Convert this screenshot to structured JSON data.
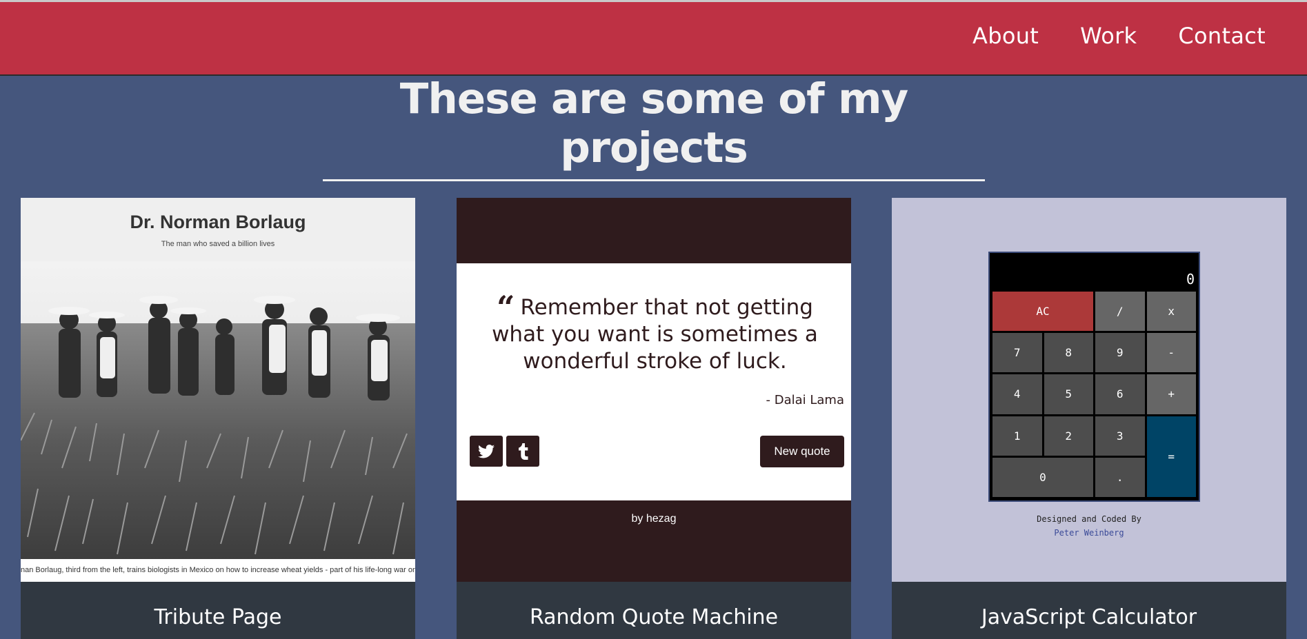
{
  "nav": {
    "items": [
      "About",
      "Work",
      "Contact"
    ]
  },
  "projects_title": "These are some of my projects",
  "projects": [
    {
      "caption": "Tribute Page",
      "name": "Dr. Norman Borlaug",
      "tagline": "The man who saved a billion lives",
      "photo_caption": "nan Borlaug, third from the left, trains biologists in Mexico on how to increase wheat yields - part of his life-long war on"
    },
    {
      "caption": "Random Quote Machine",
      "quote": "Remember that not getting what you want is sometimes a wonderful stroke of luck.",
      "author": "- Dalai Lama",
      "new_quote_label": "New quote",
      "byline": "by hezag"
    },
    {
      "caption": "JavaScript Calculator",
      "display": "0",
      "keys": [
        "AC",
        "/",
        "x",
        "7",
        "8",
        "9",
        "-",
        "4",
        "5",
        "6",
        "+",
        "1",
        "2",
        "3",
        "=",
        "0",
        "."
      ],
      "credit_line": "Designed and Coded By",
      "credit_author": "Peter Weinberg"
    }
  ],
  "colors": {
    "header": "#be3144",
    "background": "#45567d",
    "caption_bar": "#303841",
    "quote_dark": "#2f1b1d",
    "calc_bg": "#c2c2d8",
    "calc_ac": "#ac3939",
    "calc_equals": "#004466"
  },
  "icons": {
    "quote": "quote-left-icon",
    "twitter": "twitter-icon",
    "tumblr": "tumblr-icon"
  }
}
